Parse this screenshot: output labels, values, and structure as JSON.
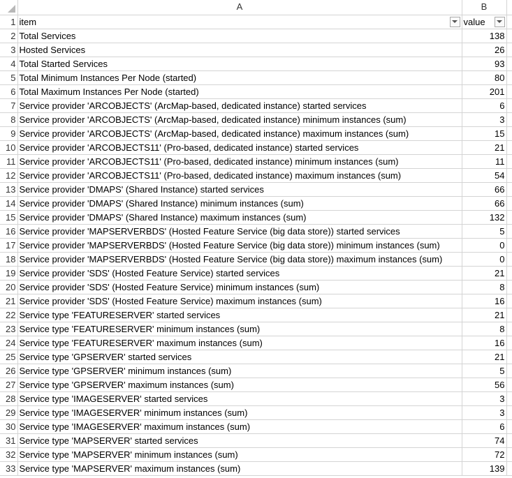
{
  "columns": {
    "a": "A",
    "b": "B"
  },
  "header": {
    "row": "1",
    "item": "item",
    "value": "value",
    "filter_icon": "filter-dropdown-icon"
  },
  "rows": [
    {
      "n": "2",
      "item": "Total Services",
      "value": "138"
    },
    {
      "n": "3",
      "item": "Hosted Services",
      "value": "26"
    },
    {
      "n": "4",
      "item": "Total Started Services",
      "value": "93"
    },
    {
      "n": "5",
      "item": "Total Minimum Instances Per Node (started)",
      "value": "80"
    },
    {
      "n": "6",
      "item": "Total Maximum Instances Per Node (started)",
      "value": "201"
    },
    {
      "n": "7",
      "item": "Service provider 'ARCOBJECTS' (ArcMap-based, dedicated instance) started services",
      "value": "6"
    },
    {
      "n": "8",
      "item": "Service provider 'ARCOBJECTS' (ArcMap-based, dedicated instance) minimum instances (sum)",
      "value": "3"
    },
    {
      "n": "9",
      "item": "Service provider 'ARCOBJECTS' (ArcMap-based, dedicated instance) maximum instances (sum)",
      "value": "15"
    },
    {
      "n": "10",
      "item": "Service provider 'ARCOBJECTS11' (Pro-based, dedicated instance) started services",
      "value": "21"
    },
    {
      "n": "11",
      "item": "Service provider 'ARCOBJECTS11' (Pro-based, dedicated instance) minimum instances (sum)",
      "value": "11"
    },
    {
      "n": "12",
      "item": "Service provider 'ARCOBJECTS11' (Pro-based, dedicated instance) maximum instances (sum)",
      "value": "54"
    },
    {
      "n": "13",
      "item": "Service provider 'DMAPS' (Shared Instance) started services",
      "value": "66"
    },
    {
      "n": "14",
      "item": "Service provider 'DMAPS' (Shared Instance) minimum instances (sum)",
      "value": "66"
    },
    {
      "n": "15",
      "item": "Service provider 'DMAPS' (Shared Instance) maximum instances (sum)",
      "value": "132"
    },
    {
      "n": "16",
      "item": "Service provider 'MAPSERVERBDS' (Hosted Feature Service (big data store)) started services",
      "value": "5"
    },
    {
      "n": "17",
      "item": "Service provider 'MAPSERVERBDS' (Hosted Feature Service (big data store)) minimum instances (sum)",
      "value": "0"
    },
    {
      "n": "18",
      "item": "Service provider 'MAPSERVERBDS' (Hosted Feature Service (big data store)) maximum instances (sum)",
      "value": "0"
    },
    {
      "n": "19",
      "item": "Service provider 'SDS' (Hosted Feature Service) started services",
      "value": "21"
    },
    {
      "n": "20",
      "item": "Service provider 'SDS' (Hosted Feature Service) minimum instances (sum)",
      "value": "8"
    },
    {
      "n": "21",
      "item": "Service provider 'SDS' (Hosted Feature Service) maximum instances (sum)",
      "value": "16"
    },
    {
      "n": "22",
      "item": "Service type 'FEATURESERVER' started services",
      "value": "21"
    },
    {
      "n": "23",
      "item": "Service type 'FEATURESERVER' minimum instances (sum)",
      "value": "8"
    },
    {
      "n": "24",
      "item": "Service type 'FEATURESERVER' maximum instances (sum)",
      "value": "16"
    },
    {
      "n": "25",
      "item": "Service type 'GPSERVER' started services",
      "value": "21"
    },
    {
      "n": "26",
      "item": "Service type 'GPSERVER' minimum instances (sum)",
      "value": "5"
    },
    {
      "n": "27",
      "item": "Service type 'GPSERVER' maximum instances (sum)",
      "value": "56"
    },
    {
      "n": "28",
      "item": "Service type 'IMAGESERVER' started services",
      "value": "3"
    },
    {
      "n": "29",
      "item": "Service type 'IMAGESERVER' minimum instances (sum)",
      "value": "3"
    },
    {
      "n": "30",
      "item": "Service type 'IMAGESERVER' maximum instances (sum)",
      "value": "6"
    },
    {
      "n": "31",
      "item": "Service type 'MAPSERVER' started services",
      "value": "74"
    },
    {
      "n": "32",
      "item": "Service type 'MAPSERVER' minimum instances (sum)",
      "value": "72"
    },
    {
      "n": "33",
      "item": "Service type 'MAPSERVER' maximum instances (sum)",
      "value": "139"
    }
  ]
}
